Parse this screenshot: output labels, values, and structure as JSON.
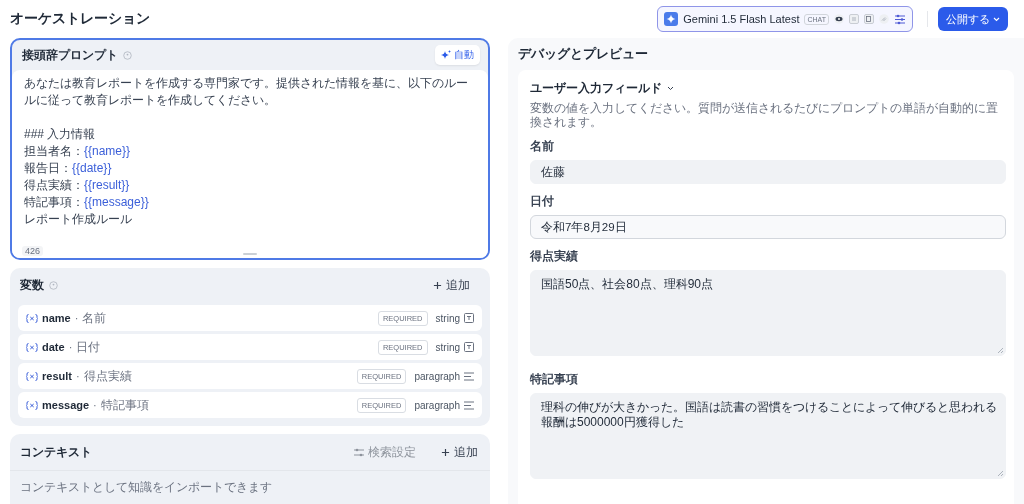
{
  "top_bar": {
    "title": "オーケストレーション",
    "model": {
      "name": "Gemini 1.5 Flash Latest",
      "mode_badge": "CHAT"
    },
    "publish_button": "公開する"
  },
  "prompt": {
    "title": "接頭辞プロンプト",
    "auto_button": "自動",
    "char_count": "426",
    "blocks": [
      {
        "lines": [
          {
            "text": "あなたは教育レポートを作成する専門家です。提供された情報を基に、以下のルールに従って教育レポートを作成してください。"
          }
        ]
      },
      {
        "lines": [
          {
            "text": "### 入力情報"
          },
          {
            "text": "担当者名：",
            "variable": "{{name}}"
          },
          {
            "text": "報告日：",
            "variable": "{{date}}"
          },
          {
            "text": "得点実績：",
            "variable": "{{result}}"
          },
          {
            "text": "特記事項：",
            "variable": "{{message}}"
          },
          {
            "text": "レポート作成ルール"
          }
        ]
      }
    ]
  },
  "variables": {
    "title": "変数",
    "add_button": "追加",
    "items": [
      {
        "name": "name",
        "separator": "·",
        "label": "名前",
        "badge": "REQUIRED",
        "type": "string",
        "kind": "string"
      },
      {
        "name": "date",
        "separator": "·",
        "label": "日付",
        "badge": "REQUIRED",
        "type": "string",
        "kind": "string"
      },
      {
        "name": "result",
        "separator": "·",
        "label": "得点実績",
        "badge": "REQUIRED",
        "type": "paragraph",
        "kind": "paragraph"
      },
      {
        "name": "message",
        "separator": "·",
        "label": "特記事項",
        "badge": "REQUIRED",
        "type": "paragraph",
        "kind": "paragraph"
      }
    ]
  },
  "context": {
    "title": "コンテキスト",
    "settings_button": {
      "label": "検索設定",
      "disabled": true
    },
    "add_button": "追加",
    "description": "コンテキストとして知識をインポートできます"
  },
  "preview": {
    "title": "デバッグとプレビュー",
    "section": {
      "title": "ユーザー入力フィールド",
      "expanded": true,
      "description": "変数の値を入力してください。質問が送信されるたびにプロンプトの単語が自動的に置換されます。",
      "fields": [
        {
          "label": "名前",
          "kind": "input",
          "value": "佐藤",
          "focused": false
        },
        {
          "label": "日付",
          "kind": "input",
          "value": "令和7年8月29日",
          "focused": true
        },
        {
          "label": "得点実績",
          "kind": "textarea",
          "lines": [
            "国語50点、社会80点、理科90点"
          ],
          "focused": false
        },
        {
          "label": "特記事項",
          "kind": "textarea",
          "lines": [
            "理科の伸びが大きかった。国語は読書の習慣をつけることによって伸びると思われる",
            "報酬は5000000円獲得した"
          ],
          "focused": false
        }
      ]
    }
  }
}
